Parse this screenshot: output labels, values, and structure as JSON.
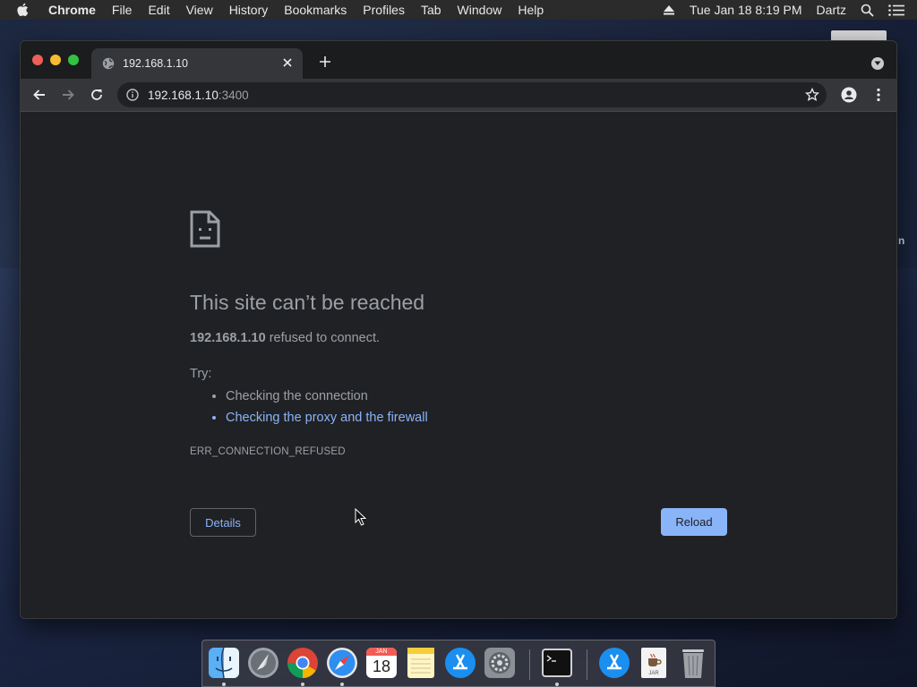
{
  "menubar": {
    "app_name": "Chrome",
    "items": [
      "File",
      "Edit",
      "View",
      "History",
      "Bookmarks",
      "Profiles",
      "Tab",
      "Window",
      "Help"
    ],
    "clock": "Tue Jan 18  8:19 PM",
    "user": "Dartz"
  },
  "browser": {
    "tab_title": "192.168.1.10",
    "url_host": "192.168.1.10",
    "url_port": ":3400"
  },
  "error_page": {
    "title": "This site can’t be reached",
    "host_bold": "192.168.1.10",
    "message_rest": " refused to connect.",
    "try_label": "Try:",
    "suggestions": [
      "Checking the connection",
      "Checking the proxy and the firewall"
    ],
    "error_code": "ERR_CONNECTION_REFUSED",
    "details_label": "Details",
    "reload_label": "Reload"
  },
  "desktop": {
    "edge_text": "n"
  },
  "dock": {
    "calendar_month": "JAN",
    "calendar_day": "18",
    "jar_label": "JAR",
    "apps": [
      "finder-icon",
      "launchpad-icon",
      "chrome-icon",
      "safari-icon",
      "calendar-icon",
      "notes-icon",
      "app-store-icon",
      "system-preferences-icon",
      "terminal-icon",
      "app-store-icon",
      "java-jar-icon",
      "trash-icon"
    ]
  },
  "colors": {
    "page_bg": "#202124",
    "link": "#8ab4f8",
    "text_muted": "#9aa0a6",
    "reload_bg": "#8ab4f8"
  }
}
